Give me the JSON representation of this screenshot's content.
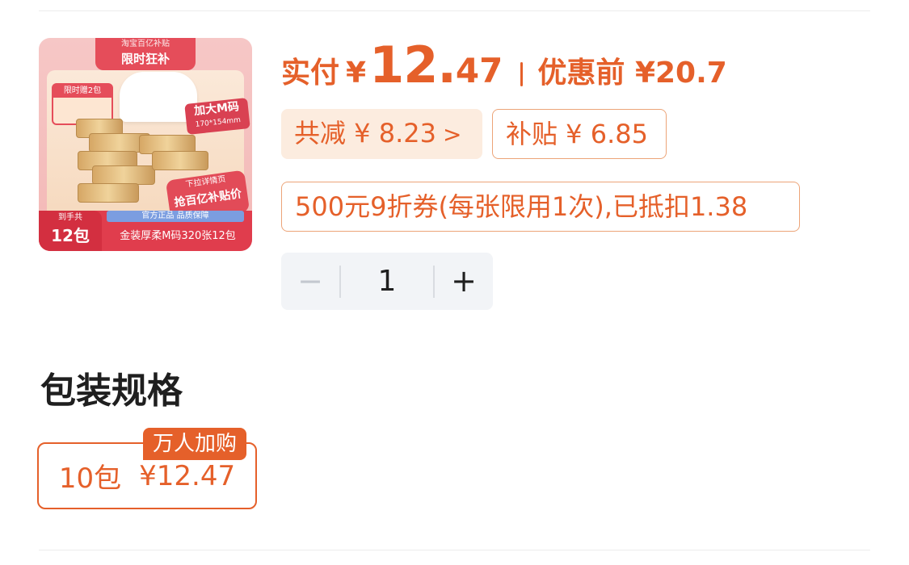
{
  "product": {
    "image": {
      "banner_top": "淘宝百亿补贴",
      "banner_main": "限时狂补",
      "limit_tag": "限时赠2包",
      "size_badge_main": "加大M码",
      "size_badge_sub": "170*154mm",
      "pull_line1": "下拉详情页",
      "pull_line2": "抢百亿补贴价",
      "guarantee": "官方正品 品质保障",
      "count_label": "到手共",
      "count_value": "12包",
      "spec": "金装厚柔M码320张12包"
    }
  },
  "price": {
    "paid_label": "实付",
    "currency": "¥",
    "paid_int": "12.",
    "paid_dec": "47",
    "before_label": "优惠前",
    "before_value": "¥20.7"
  },
  "discounts": {
    "total": "共减 ¥ 8.23",
    "total_arrow": ">",
    "subsidy": "补贴 ¥ 6.85",
    "coupon": "500元9折券(每张限用1次),已抵扣1.38"
  },
  "quantity": {
    "minus": "−",
    "value": "1",
    "plus": "+"
  },
  "package": {
    "title": "包装规格",
    "options": [
      {
        "label": "10包",
        "price": "¥12.47",
        "badge": "万人加购",
        "selected": true
      }
    ]
  },
  "colors": {
    "accent": "#e5602a",
    "accent_light_bg": "#fcecdf",
    "stepper_bg": "#f2f4f7"
  }
}
